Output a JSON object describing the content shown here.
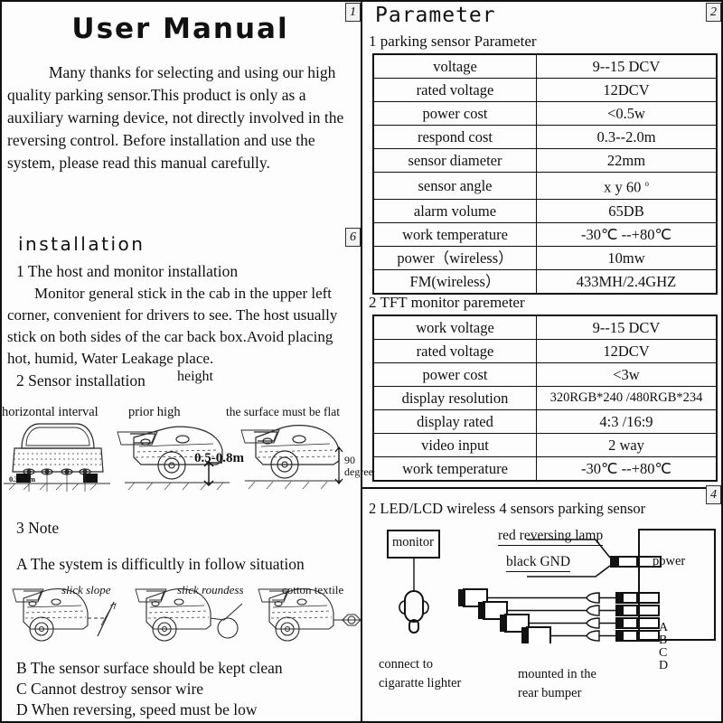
{
  "document": {
    "page_markers": {
      "left_top": "1",
      "left_mid": "6",
      "right_top": "2",
      "right_mid": "4"
    }
  },
  "left_page": {
    "title": "User  Manual",
    "intro": "Many  thanks for selecting and  using our high quality parking sensor.This product is only as a auxiliary warning device, not directly involved in the reversing control.   Before installation and use the system, please read this manual carefully.",
    "installation_heading": "installation",
    "step1_heading": "1  The  host and monitor  installation",
    "step1_body": "Monitor general stick in the cab in the upper left corner, convenient for drivers to see. The host usually stick on both sides of  the car back box.Avoid placing hot, humid, Water Leakage place.",
    "step2_heading": "2  Sensor installation",
    "step2_extra": "height",
    "figure_captions": {
      "fig1": "horizontal interval",
      "fig2": "prior high",
      "fig3": "the surface must be flat"
    },
    "figure_dims": {
      "horizontal_interval": "0.3-0.4m",
      "height_range": "0.5-0.8m",
      "angle_line1": "90",
      "angle_line2": "degree"
    },
    "step3_heading": "3  Note",
    "note_a": "A  The system  is  difficultly  in follow  situation",
    "situation_captions": {
      "s1": "slick slope",
      "s2": "slick  roundess",
      "s3": "cotton textile"
    },
    "note_b": "B  The sensor  surface should be kept clean",
    "note_c": "C  Cannot destroy sensor wire",
    "note_d": "D  When reversing, speed must be low"
  },
  "right_page": {
    "title": "Parameter",
    "section1_heading": "1  parking sensor Parameter",
    "table1": {
      "rows": [
        {
          "key": "voltage",
          "value": "9--15 DCV"
        },
        {
          "key": "rated voltage",
          "value": "12DCV"
        },
        {
          "key": "power cost",
          "value": "<0.5w"
        },
        {
          "key": "respond cost",
          "value": "0.3--2.0m"
        },
        {
          "key": "sensor diameter",
          "value": "22mm"
        },
        {
          "key": "sensor  angle",
          "value": "x  y  60"
        },
        {
          "key": "alarm volume",
          "value": "65DB"
        },
        {
          "key": "work temperature",
          "value": "-30℃ --+80℃"
        },
        {
          "key": "power（wireless）",
          "value": "10mw"
        },
        {
          "key": "FM(wireless）",
          "value": "433MH/2.4GHZ"
        }
      ]
    },
    "section2_heading": "2  TFT  monitor paremeter",
    "table2": {
      "rows": [
        {
          "key": "work   voltage",
          "value": "9--15 DCV"
        },
        {
          "key": "rated   voltage",
          "value": "12DCV"
        },
        {
          "key": "power   cost",
          "value": "<3w"
        },
        {
          "key": "display resolution",
          "value": "320RGB*240 /480RGB*234"
        },
        {
          "key": "display rated",
          "value": "4:3  /16:9"
        },
        {
          "key": "video  input",
          "value": "2   way"
        },
        {
          "key": "work   temperature",
          "value": "-30℃ --+80℃"
        }
      ]
    },
    "section3_heading": "2 LED/LCD wireless 4 sensors parking sensor",
    "diagram": {
      "monitor_box": "monitor",
      "cigarette_caption_1": "connect  to",
      "cigarette_caption_2": "cigaratte lighter",
      "red_wire": "red  reversing  lamp",
      "black_wire": "black    GND",
      "power_port": "power",
      "sensor_ports": [
        "A",
        "B",
        "C",
        "D"
      ],
      "bumper_caption_1": "mounted  in the",
      "bumper_caption_2": "rear  bumper"
    }
  }
}
